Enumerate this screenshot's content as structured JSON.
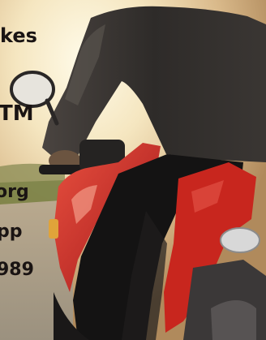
{
  "overlay_text": {
    "line1": "kes",
    "line2": "TM",
    "line3": "org",
    "line4": "pp",
    "line5": "989"
  },
  "colors": {
    "text": "#1a1413",
    "bike_red": "#c8261e",
    "jacket": "#2b2a28",
    "sky": "#f3e7c6"
  }
}
